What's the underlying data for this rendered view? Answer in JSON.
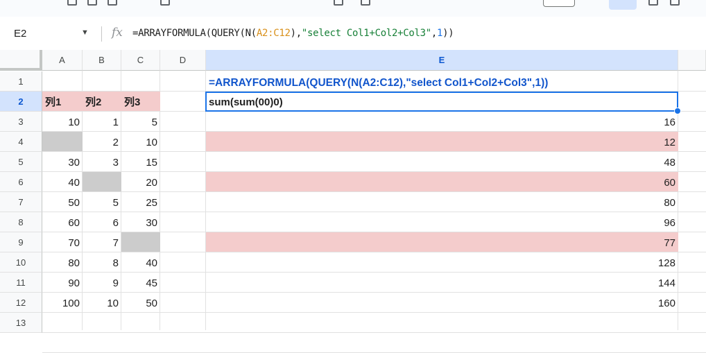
{
  "formula_bar": {
    "name_box": "E2",
    "fx_label": "fx",
    "formula_parts": [
      "=ARRAYFORMULA(QUERY(N(",
      "A2:C12",
      "),",
      "\"select Col1+Col2+Col3\"",
      ",",
      "1",
      "))"
    ]
  },
  "columns": [
    "A",
    "B",
    "C",
    "D",
    "E"
  ],
  "rows": [
    "1",
    "2",
    "3",
    "4",
    "5",
    "6",
    "7",
    "8",
    "9",
    "10",
    "11",
    "12",
    "13"
  ],
  "selected_cell": "E2",
  "cells": {
    "E1": "=ARRAYFORMULA(QUERY(N(A2:C12),\"select Col1+Col2+Col3\",1))",
    "A2": "列1",
    "B2": "列2",
    "C2": "列3",
    "E2": "sum(sum(00)0)",
    "table": [
      {
        "a": "10",
        "b": "1",
        "c": "5",
        "e": "16"
      },
      {
        "a": "",
        "b": "2",
        "c": "10",
        "e": "12"
      },
      {
        "a": "30",
        "b": "3",
        "c": "15",
        "e": "48"
      },
      {
        "a": "40",
        "b": "",
        "c": "20",
        "e": "60"
      },
      {
        "a": "50",
        "b": "5",
        "c": "25",
        "e": "80"
      },
      {
        "a": "60",
        "b": "6",
        "c": "30",
        "e": "96"
      },
      {
        "a": "70",
        "b": "7",
        "c": "",
        "e": "77"
      },
      {
        "a": "80",
        "b": "8",
        "c": "40",
        "e": "128"
      },
      {
        "a": "90",
        "b": "9",
        "c": "45",
        "e": "144"
      },
      {
        "a": "100",
        "b": "10",
        "c": "50",
        "e": "160"
      }
    ]
  },
  "colors": {
    "header_pink": "#f4cccc",
    "empty_gray": "#cccccc",
    "selection_blue": "#1a73e8",
    "formula_blue": "#1155cc"
  }
}
